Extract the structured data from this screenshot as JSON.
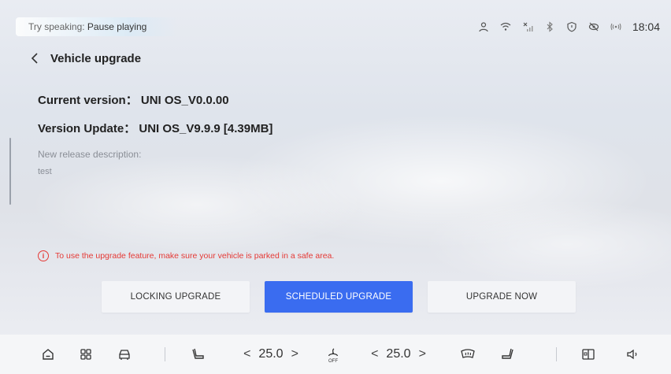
{
  "status": {
    "voice_prefix": "Try speaking: ",
    "voice_command": "Pause playing",
    "clock": "18:04"
  },
  "header": {
    "title": "Vehicle upgrade"
  },
  "versions": {
    "current": "Current version： UNI OS_V0.0.00",
    "update": "Version Update： UNI OS_V9.9.9 [4.39MB]"
  },
  "release": {
    "label": "New release description:",
    "text": "test"
  },
  "warning": "To use the upgrade feature, make sure your vehicle is parked in a safe area.",
  "buttons": {
    "locking": "LOCKING UPGRADE",
    "scheduled": "SCHEDULED UPGRADE",
    "now": "UPGRADE NOW"
  },
  "dock": {
    "left_temp": "25.0",
    "right_temp": "25.0",
    "fan_state": "OFF"
  },
  "colors": {
    "accent": "#3a6cf0",
    "warning": "#e53935"
  }
}
